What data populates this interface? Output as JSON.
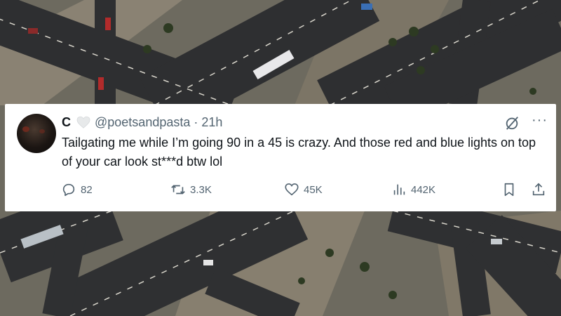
{
  "tweet": {
    "display_name": "C",
    "handle": "@poetsandpasta",
    "separator": "·",
    "time": "21h",
    "text": "Tailgating me while I’m going 90 in a 45 is crazy. And those red and blue lights on top of your car look st***d btw lol",
    "more_label": "···"
  },
  "actions": {
    "replies": "82",
    "reposts": "3.3K",
    "likes": "45K",
    "views": "442K"
  },
  "icons": {
    "verified": "heart-icon",
    "grok": "grok-slash-icon",
    "reply": "reply-icon",
    "repost": "repost-icon",
    "like": "like-icon",
    "views": "views-icon",
    "bookmark": "bookmark-icon",
    "share": "share-icon"
  },
  "colors": {
    "text": "#0f1419",
    "muted": "#536471",
    "card": "#ffffff"
  }
}
